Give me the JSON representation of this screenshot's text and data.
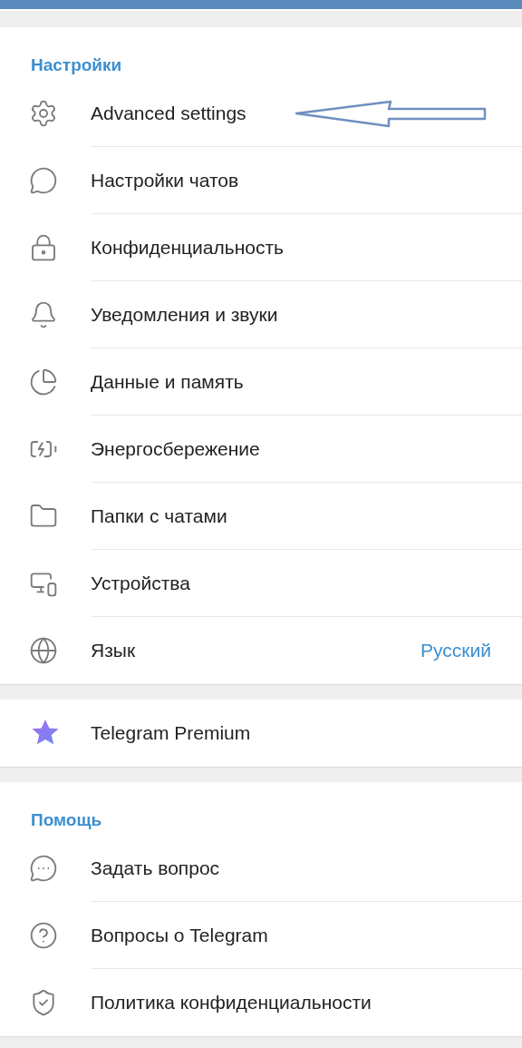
{
  "sections": [
    {
      "kind": "list",
      "header": "Настройки",
      "items": [
        {
          "label": "Advanced settings"
        },
        {
          "label": "Настройки чатов"
        },
        {
          "label": "Конфиденциальность"
        },
        {
          "label": "Уведомления и звуки"
        },
        {
          "label": "Данные и память"
        },
        {
          "label": "Энергосбережение"
        },
        {
          "label": "Папки с чатами"
        },
        {
          "label": "Устройства"
        },
        {
          "label": "Язык",
          "value": "Русский"
        }
      ]
    },
    {
      "kind": "premium",
      "items": [
        {
          "label": "Telegram Premium"
        }
      ]
    },
    {
      "kind": "list",
      "header": "Помощь",
      "items": [
        {
          "label": "Задать вопрос"
        },
        {
          "label": "Вопросы о Telegram"
        },
        {
          "label": "Политика конфиденциальности"
        }
      ]
    }
  ]
}
